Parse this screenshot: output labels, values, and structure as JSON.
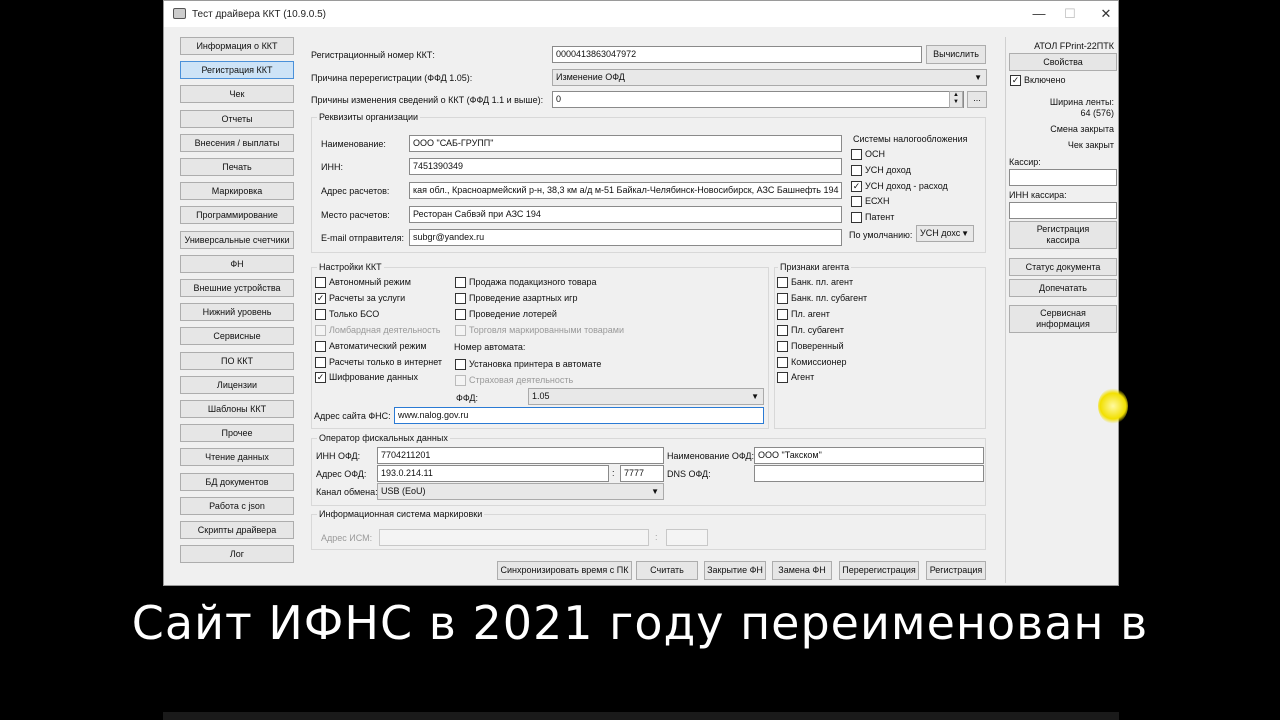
{
  "window": {
    "title": "Тест драйвера ККТ (10.9.0.5)",
    "minimize": "—",
    "maximize": "☐",
    "close": "✕"
  },
  "sidebar": {
    "items": [
      {
        "label": "Информация о ККТ"
      },
      {
        "label": "Регистрация ККТ",
        "active": true
      },
      {
        "label": "Чек"
      },
      {
        "label": "Отчеты"
      },
      {
        "label": "Внесения / выплаты"
      },
      {
        "label": "Печать"
      },
      {
        "label": "Маркировка"
      },
      {
        "label": "Программирование"
      },
      {
        "label": "Универсальные счетчики"
      },
      {
        "label": "ФН"
      },
      {
        "label": "Внешние устройства"
      },
      {
        "label": "Нижний уровень"
      },
      {
        "label": "Сервисные"
      },
      {
        "label": "ПО ККТ"
      },
      {
        "label": "Лицензии"
      },
      {
        "label": "Шаблоны ККТ"
      },
      {
        "label": "Прочее"
      },
      {
        "label": "Чтение данных"
      },
      {
        "label": "БД документов"
      },
      {
        "label": "Работа с json"
      },
      {
        "label": "Скрипты драйвера"
      },
      {
        "label": "Лог"
      }
    ]
  },
  "main": {
    "reg_number_label": "Регистрационный номер ККТ:",
    "reg_number_value": "0000413863047972",
    "calc_button": "Вычислить",
    "rereg_reason_label": "Причина перерегистрации (ФФД 1.05):",
    "rereg_reason_value": "Изменение ОФД",
    "change_reasons_label": "Причины изменения сведений о ККТ (ФФД 1.1 и выше):",
    "change_reasons_value": "0",
    "ellipsis": "...",
    "org": {
      "group_title": "Реквизиты организации",
      "name_label": "Наименование:",
      "name_value": "ООО \"САБ-ГРУПП\"",
      "inn_label": "ИНН:",
      "inn_value": "7451390349",
      "address_label": "Адрес расчетов:",
      "address_value": "кая обл., Красноармейский р-н, 38,3 км а/д м-51 Байкал-Челябинск-Новосибирск, АЗС Башнефть 194",
      "place_label": "Место расчетов:",
      "place_value": "Ресторан Сабвэй при АЗС 194",
      "email_label": "E-mail отправителя:",
      "email_value": "subgr@yandex.ru"
    },
    "tax": {
      "title": "Системы налогообложения",
      "items": [
        {
          "label": "ОСН",
          "checked": false
        },
        {
          "label": "УСН доход",
          "checked": false
        },
        {
          "label": "УСН доход - расход",
          "checked": true
        },
        {
          "label": "ЕСХН",
          "checked": false
        },
        {
          "label": "Патент",
          "checked": false
        }
      ],
      "default_label": "По умолчанию:",
      "default_value": "УСН дохс"
    },
    "kkt_settings": {
      "title": "Настройки ККТ",
      "col1": [
        {
          "label": "Автономный режим",
          "checked": false,
          "disabled": false
        },
        {
          "label": "Расчеты за услуги",
          "checked": true,
          "disabled": false
        },
        {
          "label": "Только БСО",
          "checked": false,
          "disabled": false
        },
        {
          "label": "Ломбардная деятельность",
          "checked": false,
          "disabled": true
        },
        {
          "label": "Автоматический режим",
          "checked": false,
          "disabled": false
        },
        {
          "label": "Расчеты только в интернет",
          "checked": false,
          "disabled": false
        },
        {
          "label": "Шифрование данных",
          "checked": true,
          "disabled": false
        }
      ],
      "col2": [
        {
          "label": "Продажа подакцизного товара",
          "checked": false,
          "disabled": false
        },
        {
          "label": "Проведение азартных игр",
          "checked": false,
          "disabled": false
        },
        {
          "label": "Проведение лотерей",
          "checked": false,
          "disabled": false
        },
        {
          "label": "Торговля маркированными товарами",
          "checked": false,
          "disabled": true
        }
      ],
      "automat_number_label": "Номер автомата:",
      "printer_in_automat": "Установка принтера в автомате",
      "insurance": "Страховая деятельность",
      "ffd_label": "ФФД:",
      "ffd_value": "1.05",
      "fns_site_label": "Адрес сайта ФНС:",
      "fns_site_value": "www.nalog.gov.ru"
    },
    "agent": {
      "title": "Признаки агента",
      "items": [
        {
          "label": "Банк. пл. агент"
        },
        {
          "label": "Банк. пл. субагент"
        },
        {
          "label": "Пл. агент"
        },
        {
          "label": "Пл. субагент"
        },
        {
          "label": "Поверенный"
        },
        {
          "label": "Комиссионер"
        },
        {
          "label": "Агент"
        }
      ]
    },
    "ofd": {
      "title": "Оператор фискальных данных",
      "inn_label": "ИНН ОФД:",
      "inn_value": "7704211201",
      "name_label": "Наименование ОФД:",
      "name_value": "ООО \"Такском\"",
      "address_label": "Адрес ОФД:",
      "address_value": "193.0.214.11",
      "colon": ":",
      "port_value": "7777",
      "dns_label": "DNS ОФД:",
      "dns_value": "",
      "channel_label": "Канал обмена:",
      "channel_value": "USB (EoU)"
    },
    "ism": {
      "title": "Информационная система маркировки",
      "address_label": "Адрес ИСМ:",
      "colon": ":"
    },
    "bottom_buttons": {
      "sync": "Синхронизировать время с ПК",
      "read": "Считать",
      "close_fn": "Закрытие ФН",
      "replace_fn": "Замена ФН",
      "rereg": "Перерегистрация",
      "reg": "Регистрация"
    }
  },
  "right_panel": {
    "device": "АТОЛ FPrint-22ПТК",
    "properties_button": "Свойства",
    "enabled_label": "Включено",
    "enabled": true,
    "tape_width_label": "Ширина ленты:",
    "tape_width_value": "64 (576)",
    "shift_status": "Смена закрыта",
    "receipt_status": "Чек закрыт",
    "cashier_label": "Кассир:",
    "cashier_value": "",
    "cashier_inn_label": "ИНН кассира:",
    "cashier_inn_value": "",
    "reg_cashier_button": "Регистрация кассира",
    "doc_status_button": "Статус документа",
    "reprint_button": "Допечатать",
    "service_info_button": "Сервисная информация"
  },
  "subtitle": "Сайт ИФНС в 2021 году переименован в"
}
